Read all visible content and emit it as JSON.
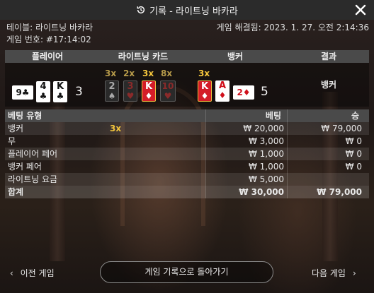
{
  "titlebar": {
    "title": "기록 - 라이트닝 바카라",
    "history_icon": "history-icon",
    "close_icon": "close-icon"
  },
  "info": {
    "table_label": "테이블: 라이트닝 바카라",
    "resolved_label": "게임 해결됨: 2023. 1. 27. 오전 2:14:36",
    "game_id_label": "게임 번호: #17:14:02"
  },
  "hand": {
    "headers": {
      "player": "플레이어",
      "lightning_cards": "라이트닝 카드",
      "banker": "뱅커",
      "result": "결과"
    },
    "player_cards": [
      {
        "rank": "9",
        "suit": "♣",
        "red": false,
        "sideways": true
      },
      {
        "rank": "4",
        "suit": "♣",
        "red": false
      },
      {
        "rank": "K",
        "suit": "♣",
        "red": false
      }
    ],
    "player_score": "3",
    "lightning": [
      {
        "mult": "3x",
        "rank": "2",
        "suit": "♠",
        "red": false,
        "lit": false
      },
      {
        "mult": "2x",
        "rank": "3",
        "suit": "♥",
        "red": true,
        "lit": false
      },
      {
        "mult": "3x",
        "rank": "K",
        "suit": "♦",
        "red": true,
        "lit": true
      },
      {
        "mult": "8x",
        "rank": "10",
        "suit": "♥",
        "red": true,
        "lit": false
      }
    ],
    "banker_mult": "3x",
    "banker_cards": [
      {
        "rank": "K",
        "suit": "♦",
        "red": true,
        "lit": true
      },
      {
        "rank": "A",
        "suit": "♦",
        "red": true
      },
      {
        "rank": "2",
        "suit": "♦",
        "red": true,
        "sideways": true
      }
    ],
    "banker_score": "5",
    "result": "뱅커"
  },
  "bets": {
    "headers": {
      "type": "베팅 유형",
      "bet": "베팅",
      "win": "승"
    },
    "rows": [
      {
        "type": "뱅커",
        "mult": "3x",
        "bet": "₩ 20,000",
        "win": "₩ 79,000"
      },
      {
        "type": "무",
        "mult": "",
        "bet": "₩ 3,000",
        "win": "₩ 0"
      },
      {
        "type": "플레이어 페어",
        "mult": "",
        "bet": "₩ 1,000",
        "win": "₩ 0"
      },
      {
        "type": "뱅커 페어",
        "mult": "",
        "bet": "₩ 1,000",
        "win": "₩ 0"
      },
      {
        "type": "라이트닝 요금",
        "mult": "",
        "bet": "₩ 5,000",
        "win": ""
      }
    ],
    "total": {
      "type": "합계",
      "bet": "₩ 30,000",
      "win": "₩ 79,000"
    }
  },
  "footer": {
    "prev_label": "이전 게임",
    "back_label": "게임 기록으로 돌아가기",
    "next_label": "다음 게임",
    "prev_icon": "chevron-left-icon",
    "next_icon": "chevron-right-icon"
  },
  "colors": {
    "gold": "#f3c53c",
    "card_red": "#d0101c",
    "header_bg": "#4a4a4a",
    "titlebar_bg": "#2b2b2b"
  }
}
